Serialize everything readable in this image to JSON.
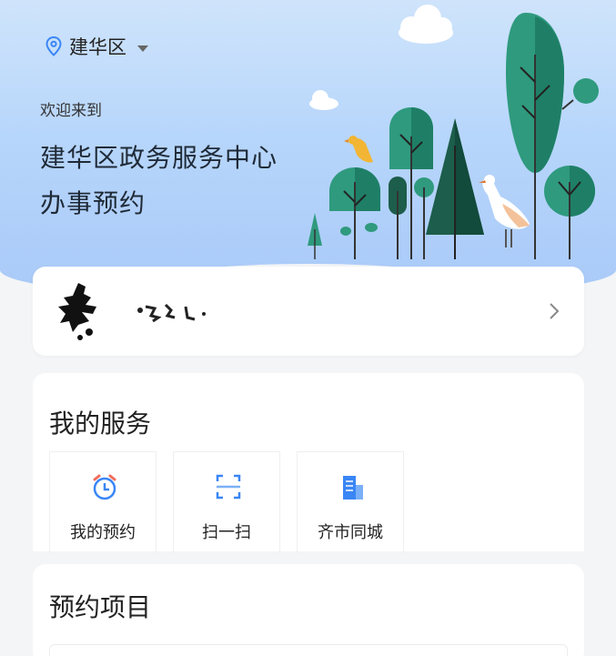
{
  "header": {
    "location": "建华区",
    "welcome": "欢迎来到",
    "title_line1": "建华区政务服务中心",
    "title_line2": "办事预约"
  },
  "user_card": {
    "avatar_icon": "avatar-icon",
    "chevron_icon": "chevron-right-icon"
  },
  "services": {
    "title": "我的服务",
    "items": [
      {
        "label": "我的预约",
        "icon": "alarm-clock-icon"
      },
      {
        "label": "扫一扫",
        "icon": "scan-icon"
      },
      {
        "label": "齐市同城",
        "icon": "building-icon"
      }
    ]
  },
  "projects": {
    "title": "预约项目"
  },
  "colors": {
    "hero_top": "#cfe4fb",
    "hero_bottom": "#a9c9f8",
    "accent_blue": "#3a86f5",
    "clock_red": "#f36c5a",
    "tree_green": "#2f9a7e",
    "tree_dark": "#1d5d4b",
    "page_bg": "#f4f5f7"
  }
}
